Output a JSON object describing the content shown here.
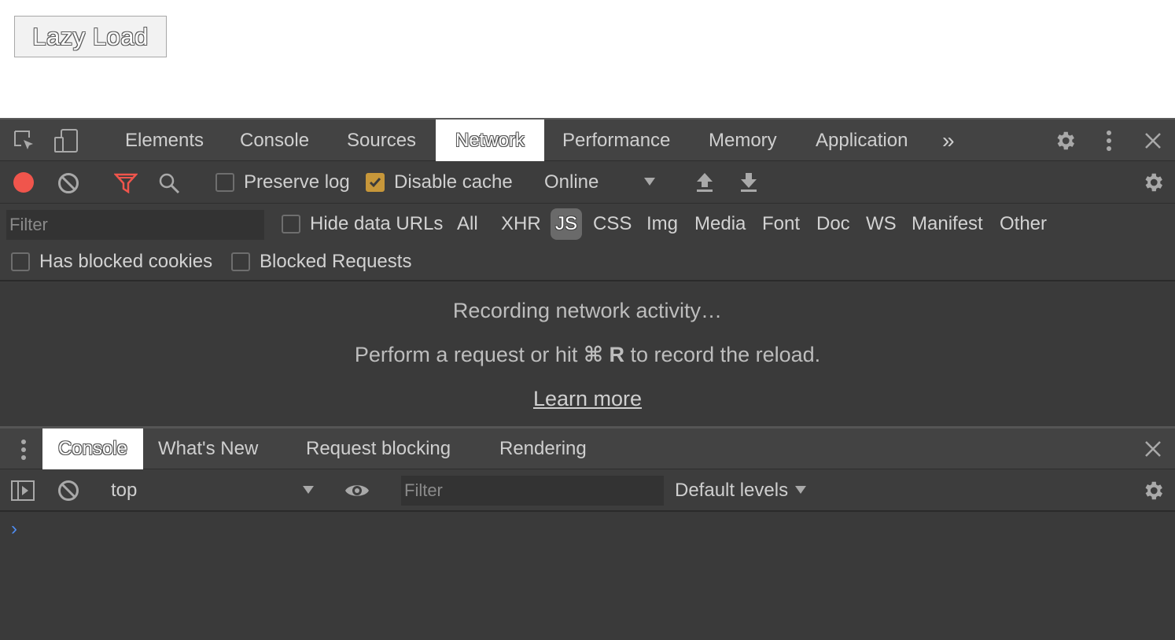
{
  "page": {
    "lazy_button_label": "Lazy Load"
  },
  "devtools": {
    "main_tabs": [
      "Elements",
      "Console",
      "Sources",
      "Network",
      "Performance",
      "Memory",
      "Application"
    ],
    "active_tab": "Network",
    "more_tabs_glyph": "»",
    "toolbar": {
      "preserve_log_label": "Preserve log",
      "preserve_log_checked": false,
      "disable_cache_label": "Disable cache",
      "disable_cache_checked": true,
      "throttling_value": "Online"
    },
    "filter": {
      "placeholder": "Filter",
      "hide_data_urls_label": "Hide data URLs",
      "types": [
        "All",
        "XHR",
        "JS",
        "CSS",
        "Img",
        "Media",
        "Font",
        "Doc",
        "WS",
        "Manifest",
        "Other"
      ],
      "active_type": "JS",
      "has_blocked_cookies_label": "Has blocked cookies",
      "blocked_requests_label": "Blocked Requests"
    },
    "empty_state": {
      "line1": "Recording network activity…",
      "line2_prefix": "Perform a request or hit",
      "line2_key": "⌘ R",
      "line2_suffix": "to record the reload.",
      "learn_more": "Learn more"
    },
    "drawer_tabs": [
      "Console",
      "What's New",
      "Request blocking",
      "Rendering"
    ],
    "active_drawer_tab": "Console",
    "console": {
      "context": "top",
      "filter_placeholder": "Filter",
      "levels": "Default levels",
      "prompt": "›"
    },
    "colors": {
      "record": "#f0554c",
      "filter_active": "#f0554c",
      "checkbox_checked": "#c7973a",
      "prompt": "#4f8cf0"
    }
  }
}
